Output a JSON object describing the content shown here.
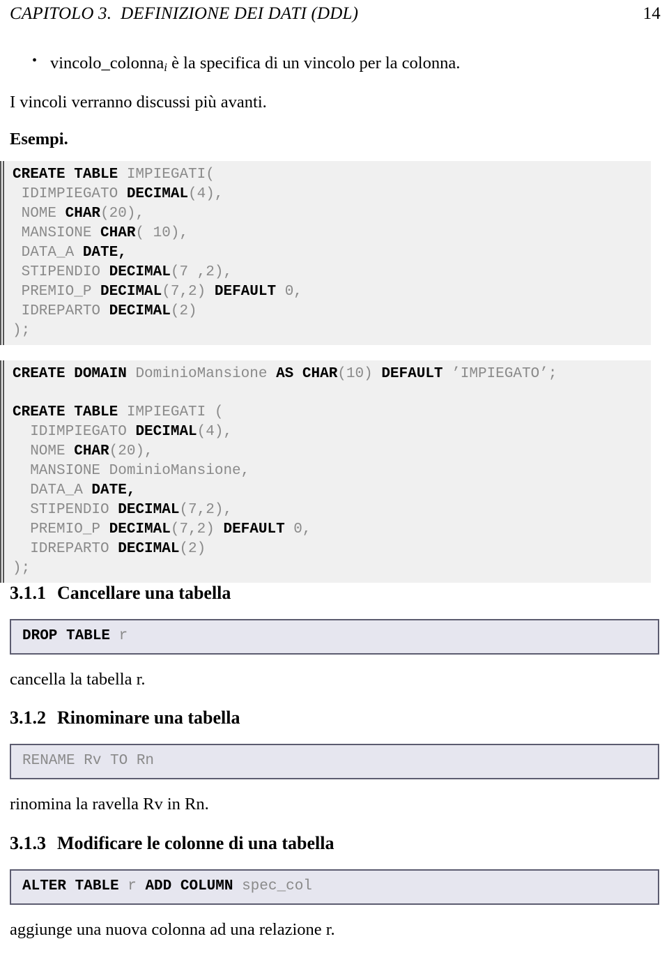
{
  "header": {
    "chapter_title": "CAPITOLO 3.  DEFINIZIONE DEI DATI (DDL)",
    "page_number": "14"
  },
  "body": {
    "bullet_1_prefix": "vincolo_colonna",
    "bullet_1_subscript": "i",
    "bullet_1_rest": " è la specifica di un vincolo per la colonna.",
    "paragraph_constraints": "I vincoli verranno discussi più avanti.",
    "examples_label": "Esempi."
  },
  "code_blocks": {
    "create_table_impiegati": [
      [
        {
          "t": "CREATE TABLE ",
          "k": true
        },
        {
          "t": "IMPIEGATI(",
          "k": false
        }
      ],
      [
        {
          "t": " IDIMPIEGATO ",
          "k": false
        },
        {
          "t": "DECIMAL",
          "k": true
        },
        {
          "t": "(4),",
          "k": false
        }
      ],
      [
        {
          "t": " NOME ",
          "k": false
        },
        {
          "t": "CHAR",
          "k": true
        },
        {
          "t": "(20),",
          "k": false
        }
      ],
      [
        {
          "t": " MANSIONE ",
          "k": false
        },
        {
          "t": "CHAR",
          "k": true
        },
        {
          "t": "( 10),",
          "k": false
        }
      ],
      [
        {
          "t": " DATA_A ",
          "k": false
        },
        {
          "t": "DATE,",
          "k": true
        }
      ],
      [
        {
          "t": " STIPENDIO ",
          "k": false
        },
        {
          "t": "DECIMAL",
          "k": true
        },
        {
          "t": "(7 ,2),",
          "k": false
        }
      ],
      [
        {
          "t": " PREMIO_P ",
          "k": false
        },
        {
          "t": "DECIMAL",
          "k": true
        },
        {
          "t": "(7,2) ",
          "k": false
        },
        {
          "t": "DEFAULT",
          "k": true
        },
        {
          "t": " 0,",
          "k": false
        }
      ],
      [
        {
          "t": " IDREPARTO ",
          "k": false
        },
        {
          "t": "DECIMAL",
          "k": true
        },
        {
          "t": "(2)",
          "k": false
        }
      ],
      [
        {
          "t": ");",
          "k": false
        }
      ]
    ],
    "create_domain_and_table": [
      [
        {
          "t": "CREATE DOMAIN ",
          "k": true
        },
        {
          "t": "DominioMansione ",
          "k": false
        },
        {
          "t": "AS CHAR",
          "k": true
        },
        {
          "t": "(10) ",
          "k": false
        },
        {
          "t": "DEFAULT",
          "k": true
        },
        {
          "t": " ’IMPIEGATO’;",
          "k": false
        }
      ],
      [],
      [
        {
          "t": "CREATE TABLE ",
          "k": true
        },
        {
          "t": "IMPIEGATI (",
          "k": false
        }
      ],
      [
        {
          "t": "  IDIMPIEGATO ",
          "k": false
        },
        {
          "t": "DECIMAL",
          "k": true
        },
        {
          "t": "(4),",
          "k": false
        }
      ],
      [
        {
          "t": "  NOME ",
          "k": false
        },
        {
          "t": "CHAR",
          "k": true
        },
        {
          "t": "(20),",
          "k": false
        }
      ],
      [
        {
          "t": "  MANSIONE DominioMansione,",
          "k": false
        }
      ],
      [
        {
          "t": "  DATA_A ",
          "k": false
        },
        {
          "t": "DATE,",
          "k": true
        }
      ],
      [
        {
          "t": "  STIPENDIO ",
          "k": false
        },
        {
          "t": "DECIMAL",
          "k": true
        },
        {
          "t": "(7,2),",
          "k": false
        }
      ],
      [
        {
          "t": "  PREMIO_P ",
          "k": false
        },
        {
          "t": "DECIMAL",
          "k": true
        },
        {
          "t": "(7,2) ",
          "k": false
        },
        {
          "t": "DEFAULT",
          "k": true
        },
        {
          "t": " 0,",
          "k": false
        }
      ],
      [
        {
          "t": "  IDREPARTO ",
          "k": false
        },
        {
          "t": "DECIMAL",
          "k": true
        },
        {
          "t": "(2)",
          "k": false
        }
      ],
      [
        {
          "t": ");",
          "k": false
        }
      ]
    ]
  },
  "sections": [
    {
      "number": "3.1.1",
      "title": "Cancellare una tabella",
      "syntax": [
        {
          "t": "DROP TABLE ",
          "k": true
        },
        {
          "t": "r",
          "k": false
        }
      ],
      "caption": "cancella la tabella r."
    },
    {
      "number": "3.1.2",
      "title": "Rinominare una tabella",
      "syntax": [
        {
          "t": "RENAME Rv TO Rn",
          "k": false
        }
      ],
      "caption": "rinomina la ravella Rv in Rn."
    },
    {
      "number": "3.1.3",
      "title": "Modificare le colonne di una tabella",
      "syntax": [
        {
          "t": "ALTER TABLE ",
          "k": true
        },
        {
          "t": "r ",
          "k": false
        },
        {
          "t": "ADD COLUMN ",
          "k": true
        },
        {
          "t": "spec_col",
          "k": false
        }
      ],
      "caption": "aggiunge una nuova colonna ad una relazione r."
    }
  ],
  "colors": {
    "code_background": "#f0f0f0",
    "code_rule": "#555555",
    "syntaxbox_background": "#e6e6ef",
    "syntaxbox_border": "#5c5c70",
    "identifier_gray": "#8a8a8a",
    "keyword_black": "#000000"
  }
}
